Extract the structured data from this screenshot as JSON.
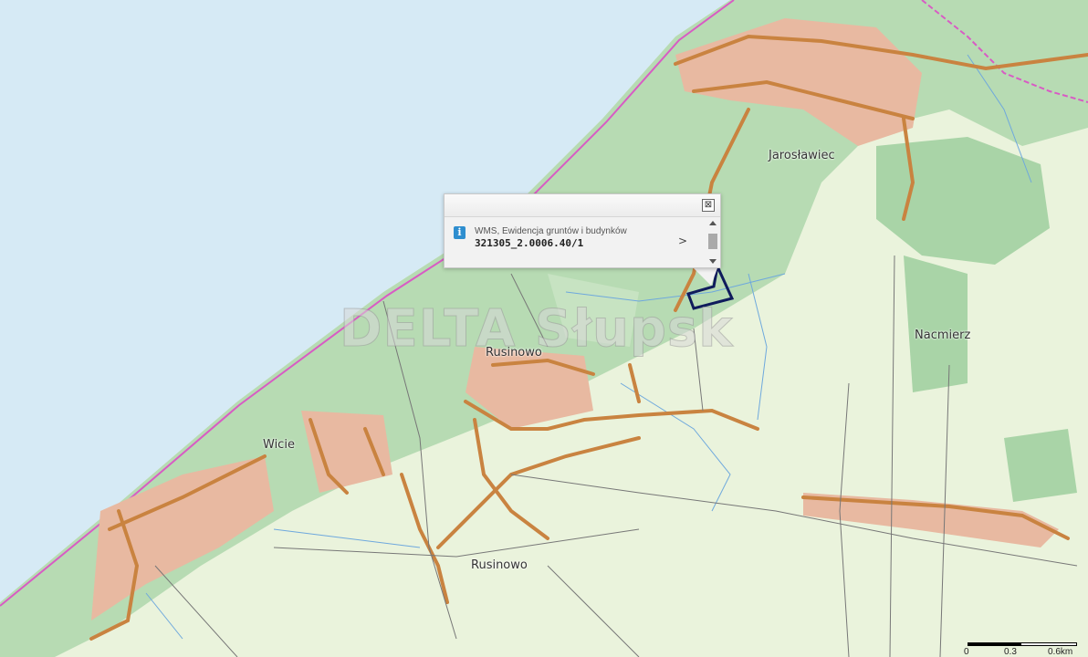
{
  "map": {
    "colors": {
      "sea": "#d6eaf5",
      "land": "#eaf3dc",
      "forest": "#a9d4a7",
      "road": "#c98340",
      "settlement": "#e8b9a1",
      "coast_boundary": "#d85bc4",
      "water_line": "#6ea8dd",
      "parcel": "#0f1b5c"
    },
    "places": [
      "Jarosławiec",
      "Nacmierz",
      "Rusinowo",
      "Wicie",
      "Rusinowo"
    ],
    "watermark": "DELTA Słupsk"
  },
  "popup": {
    "close_symbol": "⊠",
    "info_icon": "info-icon",
    "layer_name": "WMS, Ewidencja gruntów i budynków",
    "parcel_id": "321305_2.0006.40/1",
    "next_symbol": ">"
  },
  "scale": {
    "labels": [
      "0",
      "0.3",
      "0.6km"
    ]
  }
}
